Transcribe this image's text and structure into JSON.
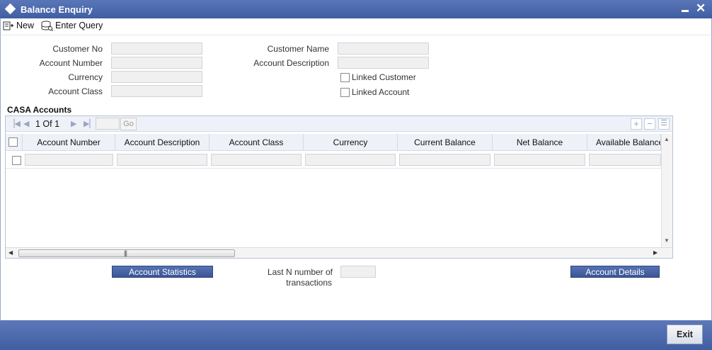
{
  "window": {
    "title": "Balance Enquiry"
  },
  "toolbar": {
    "new_label": "New",
    "enter_query_label": "Enter Query"
  },
  "form": {
    "customer_no": {
      "label": "Customer No",
      "value": ""
    },
    "account_number": {
      "label": "Account Number",
      "value": ""
    },
    "currency": {
      "label": "Currency",
      "value": ""
    },
    "account_class": {
      "label": "Account Class",
      "value": ""
    },
    "customer_name": {
      "label": "Customer Name",
      "value": ""
    },
    "account_description": {
      "label": "Account Description",
      "value": ""
    },
    "linked_customer": {
      "label": "Linked Customer",
      "checked": false
    },
    "linked_account": {
      "label": "Linked Account",
      "checked": false
    }
  },
  "casa": {
    "section_title": "CASA Accounts",
    "pager": {
      "text": "1 Of 1",
      "go_label": "Go"
    },
    "columns": [
      "Account Number",
      "Account Description",
      "Account Class",
      "Currency",
      "Current Balance",
      "Net Balance",
      "Available Balance"
    ],
    "rows": [
      {
        "checked": false,
        "cells": [
          "",
          "",
          "",
          "",
          "",
          "",
          ""
        ]
      }
    ]
  },
  "bottom": {
    "account_statistics_label": "Account Statistics",
    "last_n_label_line1": "Last N number of",
    "last_n_label_line2": "transactions",
    "last_n_value": "",
    "account_details_label": "Account Details"
  },
  "footer": {
    "exit_label": "Exit"
  }
}
